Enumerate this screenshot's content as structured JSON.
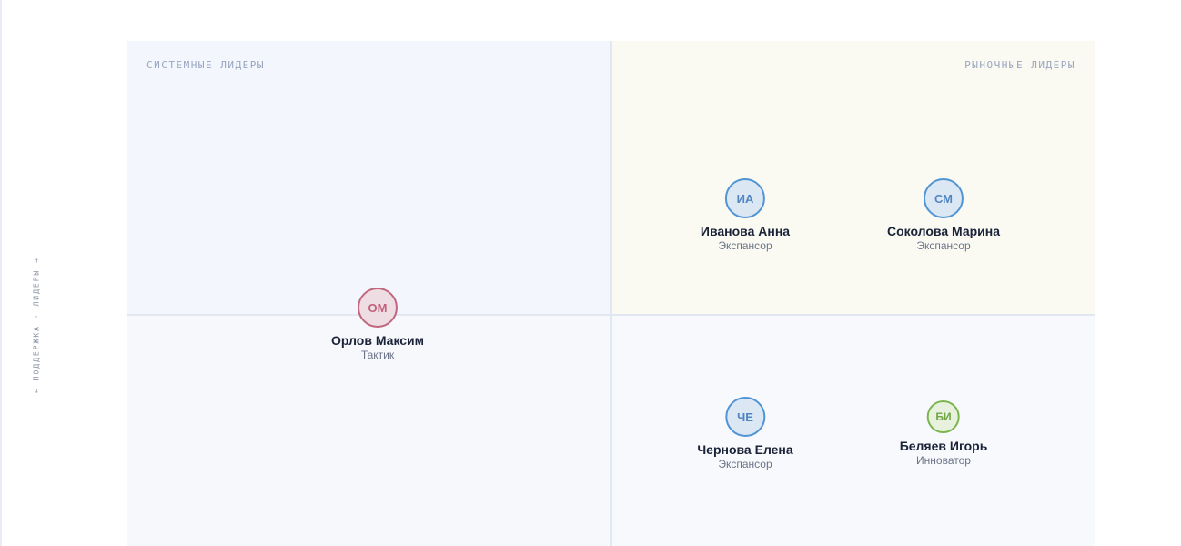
{
  "axis": {
    "y_label": "← ПОДДЕРЖКА · ЛИДЕРЫ →"
  },
  "quadrants": {
    "top_left_label": "СИСТЕМНЫЕ ЛИДЕРЫ",
    "top_right_label": "РЫНОЧНЫЕ ЛИДЕРЫ"
  },
  "people": [
    {
      "initials": "ИА",
      "name": "Иванова Анна",
      "role": "Экспансор",
      "color": "#4f94d4"
    },
    {
      "initials": "СМ",
      "name": "Соколова Марина",
      "role": "Экспансор",
      "color": "#4f94d4"
    },
    {
      "initials": "ОМ",
      "name": "Орлов Максим",
      "role": "Тактик",
      "color": "#c0667f"
    },
    {
      "initials": "ЧЕ",
      "name": "Чернова Елена",
      "role": "Экспансор",
      "color": "#4f94d4"
    },
    {
      "initials": "БИ",
      "name": "Беляев Игорь",
      "role": "Инноватор",
      "color": "#7bb54e"
    }
  ]
}
